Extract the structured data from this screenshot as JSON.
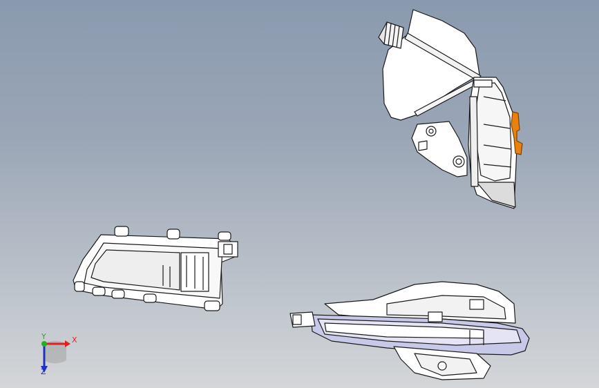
{
  "viewport": {
    "background_top": "#8a9aae",
    "background_bottom": "#d4d6d8"
  },
  "parts": [
    {
      "id": "latch-assembly",
      "accent_color": "#e8820c"
    },
    {
      "id": "inner-handle"
    },
    {
      "id": "outer-handle",
      "tint_color": "#c8c8e8"
    }
  ],
  "triad": {
    "x_label": "X",
    "y_label": "Y",
    "z_label": "Z",
    "x_color": "#e02020",
    "y_color": "#20b020",
    "z_color": "#2030c0"
  }
}
